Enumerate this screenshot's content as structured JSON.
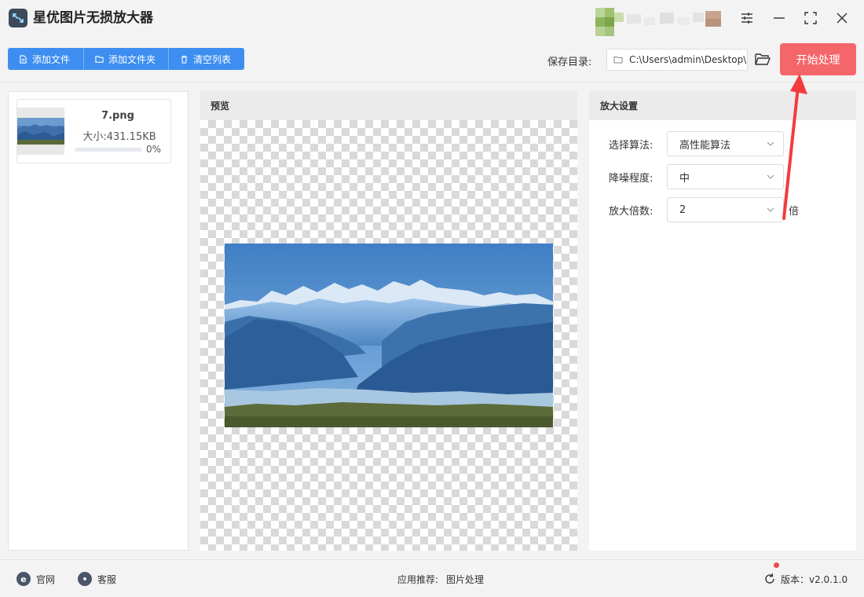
{
  "app": {
    "title": "星优图片无损放大器"
  },
  "toolbar": {
    "add_file": "添加文件",
    "add_folder": "添加文件夹",
    "clear_list": "清空列表",
    "save_dir_label": "保存目录:",
    "save_dir_value": "C:\\Users\\admin\\Desktop\\",
    "start_label": "开始处理"
  },
  "files": [
    {
      "name": "7.png",
      "size": "大小:431.15KB",
      "progress_text": "0%",
      "progress": 0
    }
  ],
  "preview": {
    "title": "预览"
  },
  "settings": {
    "title": "放大设置",
    "algorithm": {
      "label": "选择算法:",
      "value": "高性能算法"
    },
    "denoise": {
      "label": "降噪程度:",
      "value": "中"
    },
    "scale": {
      "label": "放大倍数:",
      "value": "2",
      "unit": "倍"
    }
  },
  "statusbar": {
    "website": "官网",
    "support": "客服",
    "recommend_label": "应用推荐:",
    "recommend_item": "图片处理",
    "version": "版本：v2.0.1.0"
  },
  "colors": {
    "primary": "#3d8ef0",
    "start_button": "#f5666a",
    "annotation_arrow": "#f23c3c"
  }
}
